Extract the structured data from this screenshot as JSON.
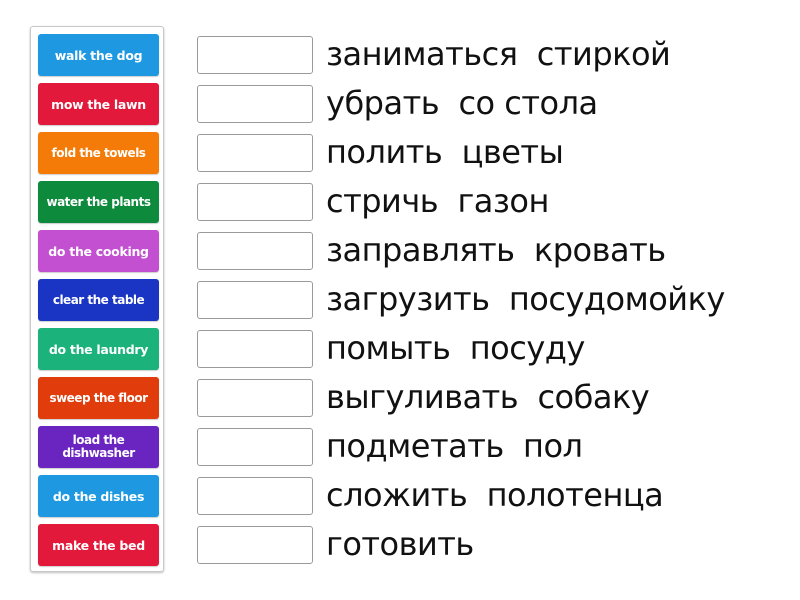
{
  "activity": {
    "type": "match-up",
    "tiles": [
      {
        "label": "walk the dog",
        "color": "#1e98e0"
      },
      {
        "label": "mow the lawn",
        "color": "#e2193b"
      },
      {
        "label": "fold the towels",
        "color": "#f47b07"
      },
      {
        "label": "water the plants",
        "color": "#0e8a3c"
      },
      {
        "label": "do the cooking",
        "color": "#c34fd1"
      },
      {
        "label": "clear the table",
        "color": "#1a34c3"
      },
      {
        "label": "do the laundry",
        "color": "#1bb27c"
      },
      {
        "label": "sweep the floor",
        "color": "#e03c0c"
      },
      {
        "label": "load the\ndishwasher",
        "color": "#6a25c0"
      },
      {
        "label": "do the dishes",
        "color": "#1e98e0"
      },
      {
        "label": "make the bed",
        "color": "#e2193b"
      }
    ],
    "targets": [
      {
        "label": "заниматься  стиркой",
        "slot_value": ""
      },
      {
        "label": "убрать  со стола",
        "slot_value": ""
      },
      {
        "label": "полить  цветы",
        "slot_value": ""
      },
      {
        "label": "стричь  газон",
        "slot_value": ""
      },
      {
        "label": "заправлять  кровать",
        "slot_value": ""
      },
      {
        "label": "загрузить  посудомойку",
        "slot_value": ""
      },
      {
        "label": "помыть  посуду",
        "slot_value": ""
      },
      {
        "label": "выгуливать  собаку",
        "slot_value": ""
      },
      {
        "label": "подметать  пол",
        "slot_value": ""
      },
      {
        "label": "сложить  полотенца",
        "slot_value": ""
      },
      {
        "label": "готовить",
        "slot_value": ""
      }
    ]
  }
}
